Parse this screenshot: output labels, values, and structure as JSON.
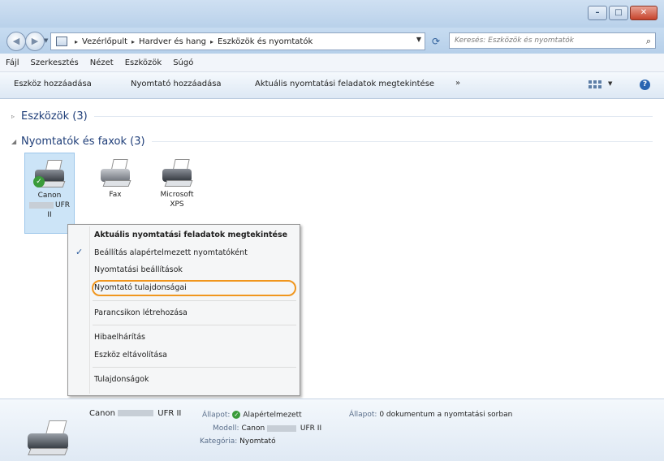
{
  "window": {
    "controls": {
      "minimize_glyph": "–",
      "maximize_glyph": "□",
      "close_glyph": "✕"
    }
  },
  "nav": {
    "back_glyph": "◀",
    "forward_glyph": "▶"
  },
  "address": {
    "crumbs": [
      "Vezérlőpult",
      "Hardver és hang",
      "Eszközök és nyomtatók"
    ],
    "separator": "▸"
  },
  "search": {
    "placeholder": "Keresés: Eszközök és nyomtatók"
  },
  "menubar": {
    "items": [
      "Fájl",
      "Szerkesztés",
      "Nézet",
      "Eszközök",
      "Súgó"
    ]
  },
  "toolbar": {
    "add_device": "Eszköz hozzáadása",
    "add_printer": "Nyomtató hozzáadása",
    "view_jobs": "Aktuális nyomtatási feladatok megtekintése",
    "more": "»",
    "help": "?"
  },
  "groups": {
    "devices": {
      "label": "Eszközök (3)",
      "toggle": "▹"
    },
    "printers": {
      "label": "Nyomtatók és faxok (3)",
      "toggle": "◢"
    }
  },
  "printers": [
    {
      "line1": "Canon",
      "line2": "UFR",
      "line3": "II",
      "selected": true,
      "default": true
    },
    {
      "line1": "Fax",
      "line2": "",
      "line3": "",
      "selected": false,
      "default": false
    },
    {
      "line1": "Microsoft",
      "line2": "XPS",
      "line3": "",
      "selected": false,
      "default": false
    }
  ],
  "context_menu": {
    "items": [
      "Aktuális nyomtatási feladatok megtekintése",
      "Beállítás alapértelmezett nyomtatóként",
      "Nyomtatási beállítások",
      "Nyomtató tulajdonságai",
      "Parancsikon létrehozása",
      "Hibaelhárítás",
      "Eszköz eltávolítása",
      "Tulajdonságok"
    ],
    "checked_item": "Beállítás alapértelmezett nyomtatóként",
    "check_glyph": "✓",
    "highlighted_item": "Nyomtató tulajdonságai"
  },
  "details": {
    "name_prefix": "Canon",
    "name_suffix": "UFR II",
    "state_label": "Állapot:",
    "state_value": "Alapértelmezett",
    "model_label": "Modell:",
    "model_prefix": "Canon",
    "model_suffix": "UFR II",
    "category_label": "Kategória:",
    "category_value": "Nyomtató",
    "status_label": "Állapot:",
    "status_value": "0 dokumentum a nyomtatási sorban"
  },
  "colors": {
    "highlight_ring": "#f0961e",
    "selection": "#cce4f7",
    "title_bar": "#b9d1ea"
  }
}
